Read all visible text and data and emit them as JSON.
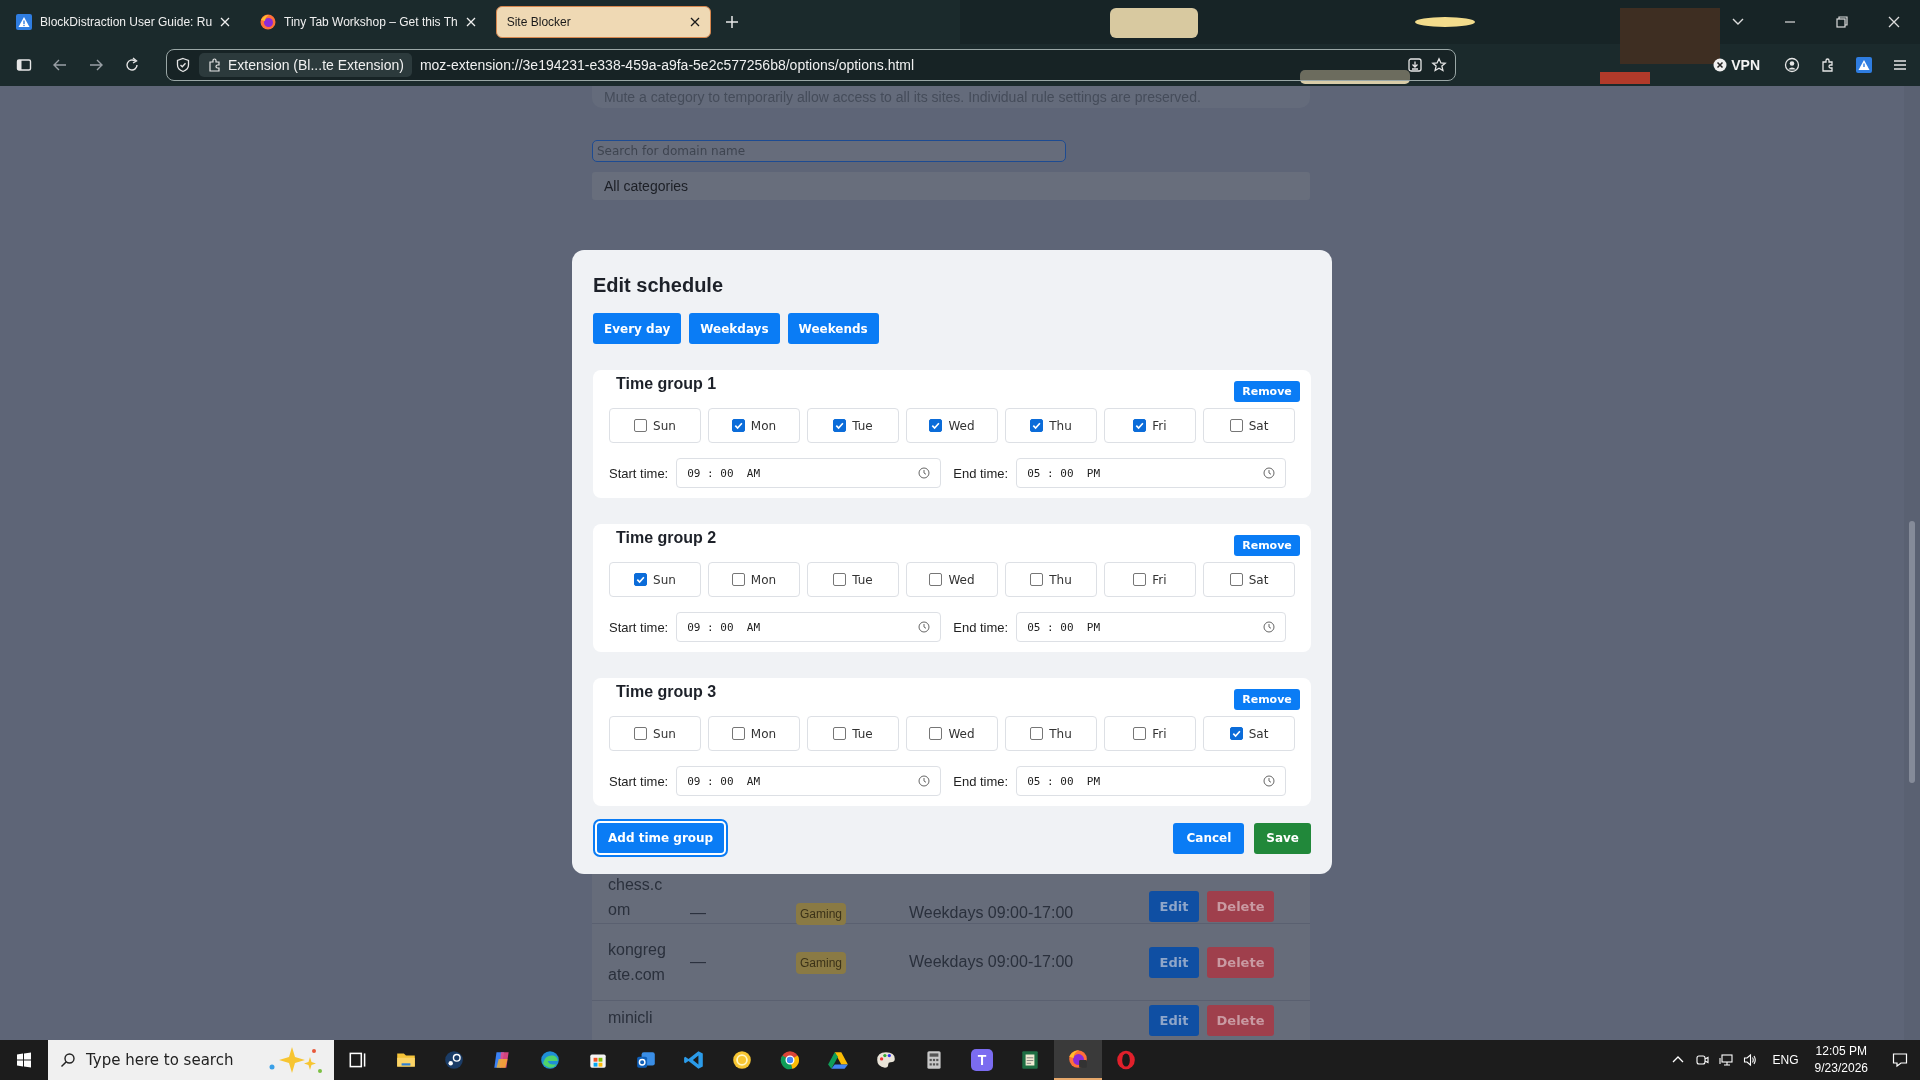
{
  "browser": {
    "tabs": [
      {
        "title": "BlockDistraction User Guide: Ru",
        "selected": false
      },
      {
        "title": "Tiny Tab Workshop – Get this Th",
        "selected": false
      },
      {
        "title": "Site Blocker",
        "selected": true
      }
    ],
    "identity": "Extension (Bl...te Extension)",
    "url": "moz-extension://3e194231-e338-459a-a9fa-5e2c577256b8/options/options.html",
    "vpn": "VPN"
  },
  "page": {
    "mute_note": "Mute a category to temporarily allow access to all its sites. Individual rule settings are preserved.",
    "search": {
      "placeholder": "Search for domain name"
    },
    "category_filter": "All categories",
    "rows": [
      {
        "domain": "chess.com",
        "dash": "—",
        "category": "Gaming",
        "schedule": "Weekdays 09:00-17:00",
        "edit": "Edit",
        "delete": "Delete"
      },
      {
        "domain": "kongregate.com",
        "dash": "—",
        "category": "Gaming",
        "schedule": "Weekdays 09:00-17:00",
        "edit": "Edit",
        "delete": "Delete"
      },
      {
        "domain": "minicli",
        "edit": "Edit",
        "delete": "Delete"
      }
    ]
  },
  "modal": {
    "title": "Edit schedule",
    "presets": [
      "Every day",
      "Weekdays",
      "Weekends"
    ],
    "groups": [
      {
        "title": "Time group 1",
        "remove": "Remove",
        "days": [
          {
            "label": "Sun",
            "checked": false
          },
          {
            "label": "Mon",
            "checked": true
          },
          {
            "label": "Tue",
            "checked": true
          },
          {
            "label": "Wed",
            "checked": true
          },
          {
            "label": "Thu",
            "checked": true
          },
          {
            "label": "Fri",
            "checked": true
          },
          {
            "label": "Sat",
            "checked": false
          }
        ],
        "start_label": "Start time:",
        "start": "09 : 00  AM",
        "end_label": "End time:",
        "end": "05 : 00  PM"
      },
      {
        "title": "Time group 2",
        "remove": "Remove",
        "days": [
          {
            "label": "Sun",
            "checked": true
          },
          {
            "label": "Mon",
            "checked": false
          },
          {
            "label": "Tue",
            "checked": false
          },
          {
            "label": "Wed",
            "checked": false
          },
          {
            "label": "Thu",
            "checked": false
          },
          {
            "label": "Fri",
            "checked": false
          },
          {
            "label": "Sat",
            "checked": false
          }
        ],
        "start_label": "Start time:",
        "start": "09 : 00  AM",
        "end_label": "End time:",
        "end": "05 : 00  PM"
      },
      {
        "title": "Time group 3",
        "remove": "Remove",
        "days": [
          {
            "label": "Sun",
            "checked": false
          },
          {
            "label": "Mon",
            "checked": false
          },
          {
            "label": "Tue",
            "checked": false
          },
          {
            "label": "Wed",
            "checked": false
          },
          {
            "label": "Thu",
            "checked": false
          },
          {
            "label": "Fri",
            "checked": false
          },
          {
            "label": "Sat",
            "checked": true
          }
        ],
        "start_label": "Start time:",
        "start": "09 : 00  AM",
        "end_label": "End time:",
        "end": "05 : 00  PM"
      }
    ],
    "add": "Add time group",
    "cancel": "Cancel",
    "save": "Save"
  },
  "taskbar": {
    "search": "Type here to search",
    "teams_letter": "T",
    "language": "ENG",
    "time": "12:05 PM",
    "date": "9/23/2026"
  }
}
